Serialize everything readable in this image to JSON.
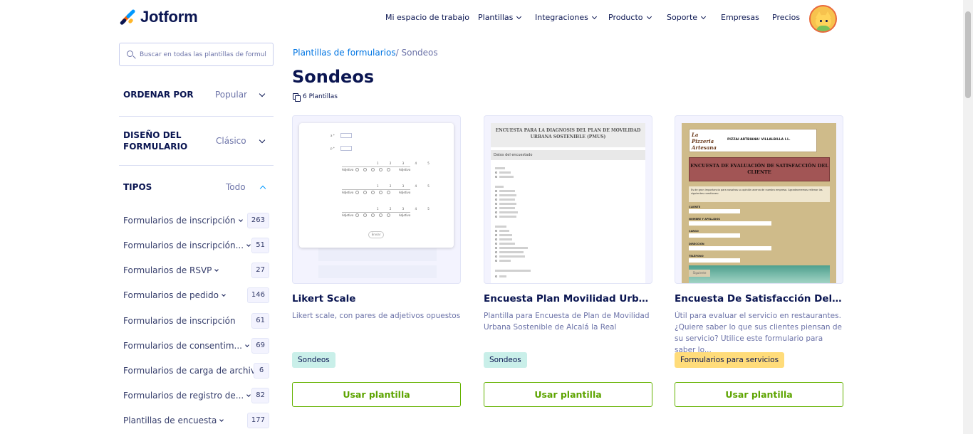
{
  "header": {
    "logo_text": "Jotform",
    "nav": [
      {
        "label": "Mi espacio de trabajo",
        "dropdown": false
      },
      {
        "label": "Plantillas",
        "dropdown": true
      },
      {
        "label": "Integraciones",
        "dropdown": true
      },
      {
        "label": "Producto",
        "dropdown": true
      },
      {
        "label": "Soporte",
        "dropdown": true
      },
      {
        "label": "Empresas",
        "dropdown": false
      },
      {
        "label": "Precios",
        "dropdown": false
      }
    ]
  },
  "sidebar": {
    "search_placeholder": "Buscar en todas las plantillas de formul",
    "sort": {
      "title": "ORDENAR POR",
      "value": "Popular"
    },
    "design": {
      "title": "DISEÑO DEL FORMULARIO",
      "value": "Clásico"
    },
    "types": {
      "title": "TIPOS",
      "value": "Todo",
      "items": [
        {
          "label": "Formularios de inscripción",
          "count": "263",
          "dropdown": true
        },
        {
          "label": "Formularios de inscripción...",
          "count": "51",
          "dropdown": true
        },
        {
          "label": "Formularios de RSVP",
          "count": "27",
          "dropdown": true
        },
        {
          "label": "Formularios de pedido",
          "count": "146",
          "dropdown": true
        },
        {
          "label": "Formularios de inscripción",
          "count": "61",
          "dropdown": false
        },
        {
          "label": "Formularios de consentim...",
          "count": "69",
          "dropdown": true
        },
        {
          "label": "Formularios de carga de archivo",
          "count": "6",
          "dropdown": false
        },
        {
          "label": "Formularios de registro de...",
          "count": "82",
          "dropdown": true
        },
        {
          "label": "Plantillas de encuesta",
          "count": "177",
          "dropdown": true
        }
      ]
    }
  },
  "main": {
    "breadcrumb": {
      "link": "Plantillas de formularios",
      "separator": "/",
      "current": "Sondeos"
    },
    "title": "Sondeos",
    "template_count": "6 Plantillas",
    "cards": [
      {
        "title": "Likert Scale",
        "description": "Likert scale, con pares de adjetivos opuestos",
        "tag": "Sondeos",
        "tag_color": "#c9efe9",
        "button": "Usar plantilla"
      },
      {
        "title": "Encuesta Plan Movilidad Urbana ...",
        "description": "Plantilla para Encuesta de Plan de Movilidad Urbana Sostenible de Alcalá la Real",
        "tag": "Sondeos",
        "tag_color": "#c9efe9",
        "button": "Usar plantilla"
      },
      {
        "title": "Encuesta De Satisfacción Del Clie...",
        "description": "Útil para evaluar el servicio en restaurantes. ¿Quiere saber lo que sus clientes piensan de su servicio? Utilice este formulario para saber lo...",
        "tag": "Formularios para servicios",
        "tag_color": "#ffdc7a",
        "button": "Usar plantilla"
      }
    ]
  },
  "previews": {
    "likert": {
      "field_labels": [
        "a *",
        "p *"
      ],
      "scale_numbers": "1 2 3 4 5",
      "left_word": "Adjetivo",
      "right_word": "Adjetivo",
      "submit": "Enviar"
    },
    "encuesta": {
      "title": "ENCUESTA PARA LA DIAGNOSIS DEL PLAN DE MOVILIDAD URBANA SOSTENIBLE (PMUS)",
      "section": "Datos del encuestado"
    },
    "pizzeria": {
      "logo_mark": "La Pizzeria Artesana",
      "business": "PIZZAI ARTBIANA! VILLALBILLA I.L.",
      "banner": "ENCUESTA DE EVALUACIÓN DE SATISFACCIÓN DEL CLIENTE",
      "intro": "Es de gran importancia para nosotros su opinión acerca de nuestra empresa. Agradeceremos rellenar las siguientes cuestiones:",
      "fields": [
        "CLIENTE",
        "NOMBRE Y APELLIDOS",
        "CARGO",
        "DIRECCIÓN",
        "TELÉFONO"
      ],
      "submit": "Siguiente"
    }
  },
  "colors": {
    "navy": "#0a1551",
    "link_blue": "#0075e3",
    "button_green": "#64b200",
    "tag_green": "#c9efe9",
    "tag_yellow": "#ffdc7a"
  }
}
